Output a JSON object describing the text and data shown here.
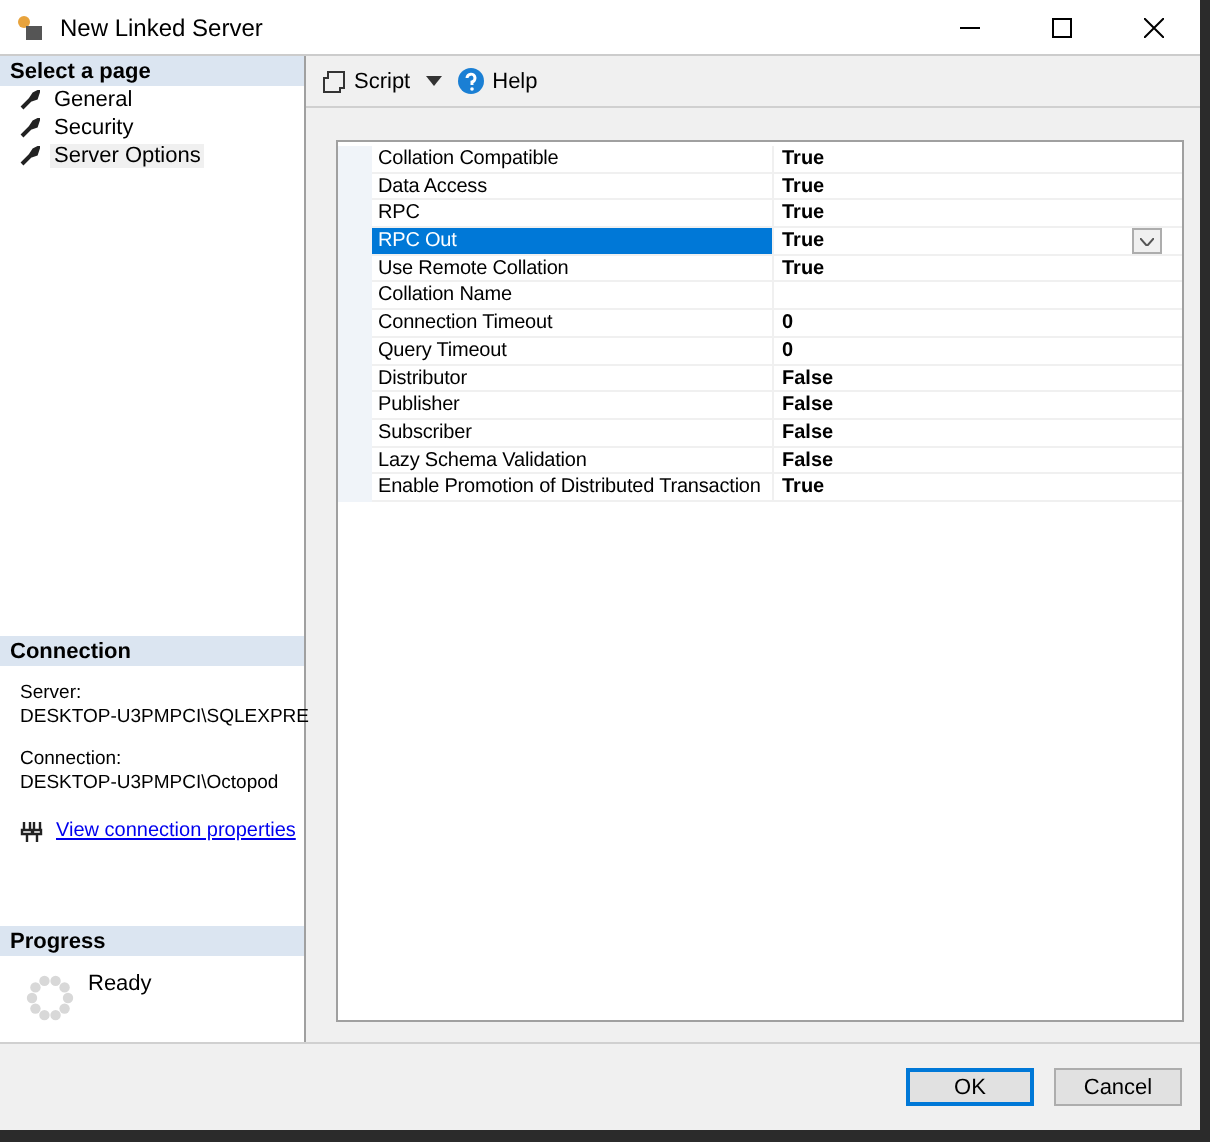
{
  "window": {
    "title": "New Linked Server"
  },
  "sidebar": {
    "header": "Select a page",
    "items": [
      {
        "label": "General",
        "selected": false
      },
      {
        "label": "Security",
        "selected": false
      },
      {
        "label": "Server Options",
        "selected": true
      }
    ]
  },
  "toolbar": {
    "script": "Script",
    "help": "Help"
  },
  "properties": [
    {
      "name": "Collation Compatible",
      "value": "True",
      "selected": false
    },
    {
      "name": "Data Access",
      "value": "True",
      "selected": false
    },
    {
      "name": "RPC",
      "value": "True",
      "selected": false
    },
    {
      "name": "RPC Out",
      "value": "True",
      "selected": true
    },
    {
      "name": "Use Remote Collation",
      "value": "True",
      "selected": false
    },
    {
      "name": "Collation Name",
      "selected": false
    },
    {
      "name": "Connection Timeout",
      "value": "0",
      "selected": false
    },
    {
      "name": "Query Timeout",
      "value": "0",
      "selected": false
    },
    {
      "name": "Distributor",
      "value": "False",
      "selected": false
    },
    {
      "name": "Publisher",
      "value": "False",
      "selected": false
    },
    {
      "name": "Subscriber",
      "value": "False",
      "selected": false
    },
    {
      "name": "Lazy Schema Validation",
      "value": "False",
      "selected": false
    },
    {
      "name": "Enable Promotion of Distributed Transaction",
      "value": "True",
      "selected": false
    }
  ],
  "connection": {
    "header": "Connection",
    "fields": [
      {
        "label": "Server:",
        "value": "DESKTOP-U3PMPCI\\SQLEXPRE"
      },
      {
        "label": "Connection:",
        "value": "DESKTOP-U3PMPCI\\Octopod"
      }
    ],
    "link": "View connection properties"
  },
  "progress": {
    "header": "Progress",
    "status": "Ready"
  },
  "buttons": [
    {
      "label": "OK",
      "default": true
    },
    {
      "label": "Cancel",
      "default": false
    }
  ]
}
